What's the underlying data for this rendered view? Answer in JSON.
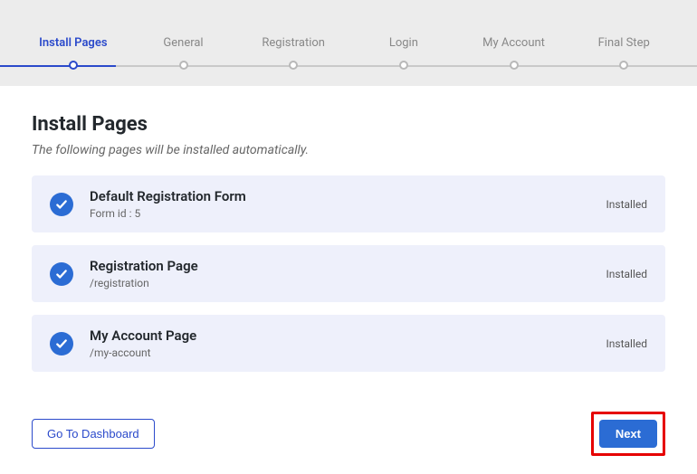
{
  "stepper": {
    "steps": [
      {
        "label": "Install Pages",
        "active": true
      },
      {
        "label": "General",
        "active": false
      },
      {
        "label": "Registration",
        "active": false
      },
      {
        "label": "Login",
        "active": false
      },
      {
        "label": "My Account",
        "active": false
      },
      {
        "label": "Final Step",
        "active": false
      }
    ]
  },
  "page": {
    "title": "Install Pages",
    "subtitle": "The following pages will be installed automatically."
  },
  "cards": [
    {
      "title": "Default Registration Form",
      "sub": "Form id : 5",
      "status": "Installed"
    },
    {
      "title": "Registration Page",
      "sub": "/registration",
      "status": "Installed"
    },
    {
      "title": "My Account Page",
      "sub": "/my-account",
      "status": "Installed"
    }
  ],
  "footer": {
    "dashboard": "Go To Dashboard",
    "next": "Next"
  }
}
